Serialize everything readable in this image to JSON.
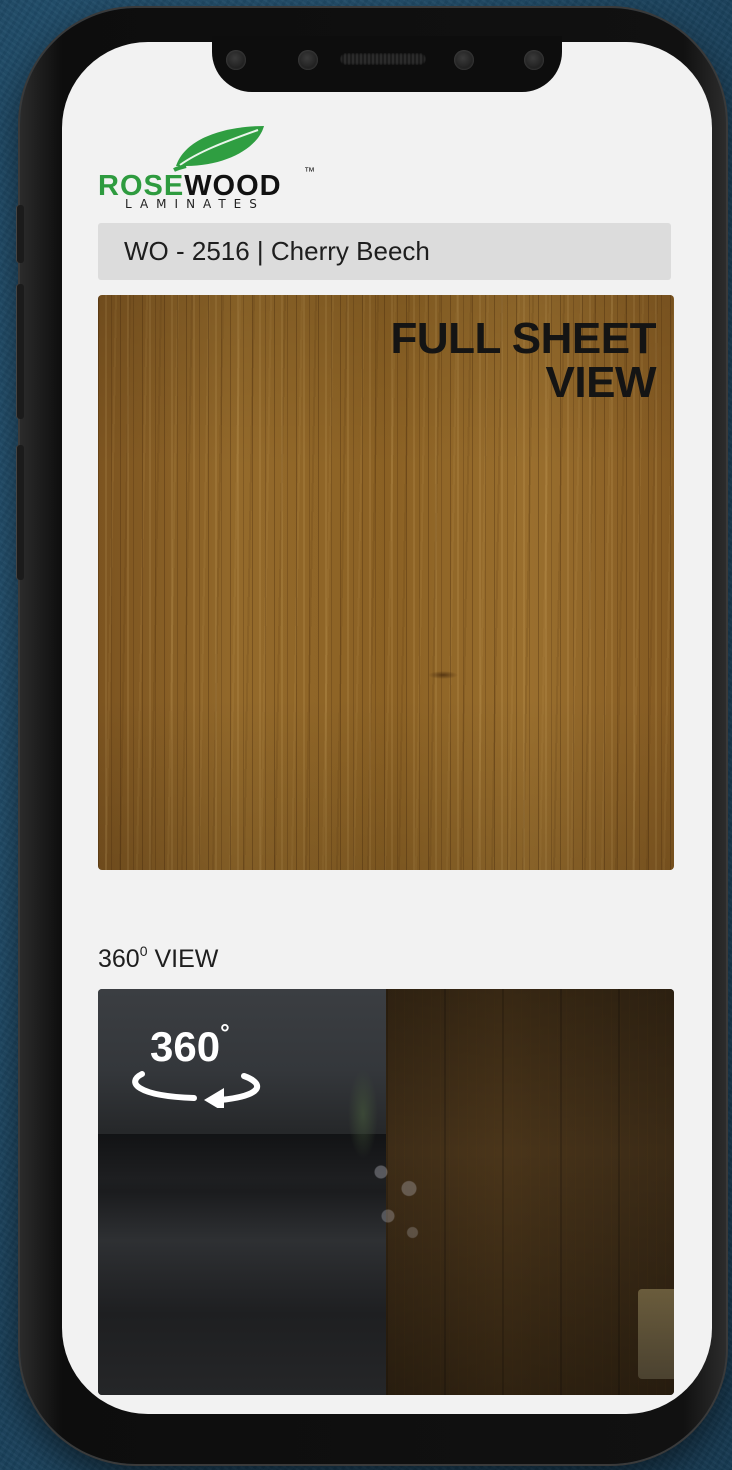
{
  "brand": {
    "name_part1": "ROSE",
    "name_part2": "WOOD",
    "trademark": "™",
    "subtitle": "LAMINATES",
    "accent_color": "#2e9b3f"
  },
  "product": {
    "title": "WO - 2516 | Cherry Beech"
  },
  "sheet_view": {
    "label_line1": "FULL SHEET",
    "label_line2": "VIEW"
  },
  "view360": {
    "heading_num": "360",
    "heading_sup": "0",
    "heading_text": " VIEW",
    "badge_num": "360",
    "badge_degree": "°"
  },
  "icons": [
    "leaf-icon",
    "rotate-360-icon"
  ]
}
